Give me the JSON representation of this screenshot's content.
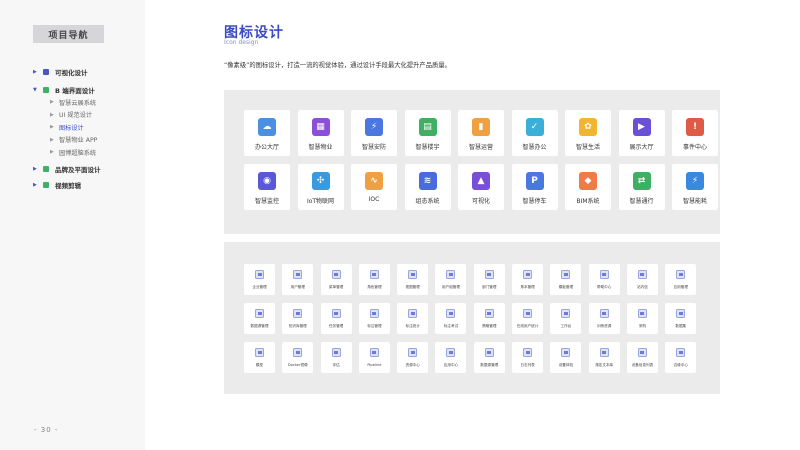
{
  "nav": {
    "title": "项目导航",
    "items": [
      {
        "label": "可视化设计",
        "icon": "chart-icon",
        "color": "#4a58c2",
        "expanded": false
      },
      {
        "label": "B 端界面设计",
        "icon": "layout-icon",
        "color": "#3fb06a",
        "expanded": true,
        "children": [
          "智慧云展系统",
          "UI 规范设计",
          "图标设计",
          "智慧物业 APP",
          "园博超脑系统"
        ],
        "active_child": 2
      },
      {
        "label": "品牌及平面设计",
        "icon": "brand-icon",
        "color": "#3fb06a",
        "expanded": false
      },
      {
        "label": "视频剪辑",
        "icon": "video-icon",
        "color": "#3fb06a",
        "expanded": false
      }
    ]
  },
  "page": {
    "title": "图标设计",
    "subtitle": "Icon design",
    "description": "“像素级”的图标设计，打造一流的视觉体验，通过设计手段最大化提升产品质量。",
    "number": "- 30 -"
  },
  "big_icons": [
    {
      "label": "办公大厅",
      "color": "#4a8fe0",
      "icon": "cloud-upload-icon",
      "glyph": "☁"
    },
    {
      "label": "智慧物业",
      "color": "#8c4fd8",
      "icon": "building-icon",
      "glyph": "▦"
    },
    {
      "label": "智慧安防",
      "color": "#4a78e0",
      "icon": "shield-bolt-icon",
      "glyph": "⚡"
    },
    {
      "label": "智慧楼宇",
      "color": "#3fb063",
      "icon": "tower-icon",
      "glyph": "▤"
    },
    {
      "label": "智慧运营",
      "color": "#f0a040",
      "icon": "bar-chart-icon",
      "glyph": "▮"
    },
    {
      "label": "智慧办公",
      "color": "#3ab0d8",
      "icon": "monitor-check-icon",
      "glyph": "✓"
    },
    {
      "label": "智慧生活",
      "color": "#f2b530",
      "icon": "life-ring-icon",
      "glyph": "✿"
    },
    {
      "label": "展示大厅",
      "color": "#6a4fd8",
      "icon": "play-icon",
      "glyph": "▶"
    },
    {
      "label": "事件中心",
      "color": "#e05a48",
      "icon": "alert-icon",
      "glyph": "!"
    },
    {
      "label": "智慧监控",
      "color": "#5a58d8",
      "icon": "camera-icon",
      "glyph": "◉"
    },
    {
      "label": "IoT物联网",
      "color": "#3a9ae0",
      "icon": "network-icon",
      "glyph": "✣"
    },
    {
      "label": "IOC",
      "color": "#f0a040",
      "icon": "line-chart-icon",
      "glyph": "∿"
    },
    {
      "label": "组态系统",
      "color": "#4a6ae0",
      "icon": "layers-icon",
      "glyph": "≋"
    },
    {
      "label": "可视化",
      "color": "#7a4fd8",
      "icon": "image-icon",
      "glyph": "▲"
    },
    {
      "label": "智慧停车",
      "color": "#4a78e0",
      "icon": "parking-icon",
      "glyph": "P"
    },
    {
      "label": "BIM系统",
      "color": "#f07a48",
      "icon": "cube-icon",
      "glyph": "◆"
    },
    {
      "label": "智慧通行",
      "color": "#3fb063",
      "icon": "swap-icon",
      "glyph": "⇄"
    },
    {
      "label": "智慧能耗",
      "color": "#3a88e0",
      "icon": "energy-icon",
      "glyph": "⚡"
    }
  ],
  "small_icons": [
    "企业管理",
    "用户管理",
    "菜单管理",
    "角色管理",
    "视图管理",
    "用户组管理",
    "部门管理",
    "角本管理",
    "模板管理",
    "帮助中心",
    "站内信",
    "应用管理",
    "数据源管理",
    "知识库管理",
    "任务管理",
    "标注管理",
    "标注统计",
    "标注考试",
    "策略管理",
    "在线用户统计",
    "工作台",
    "训练资源",
    "采购",
    "数据集",
    "模型",
    "Docker镜像",
    "评估",
    "Pipeline",
    "资源中心",
    "应用中心",
    "数据源管理",
    "日志列表",
    "设置体验",
    "规定文本库",
    "设备信息列表",
    "边缘中心"
  ]
}
